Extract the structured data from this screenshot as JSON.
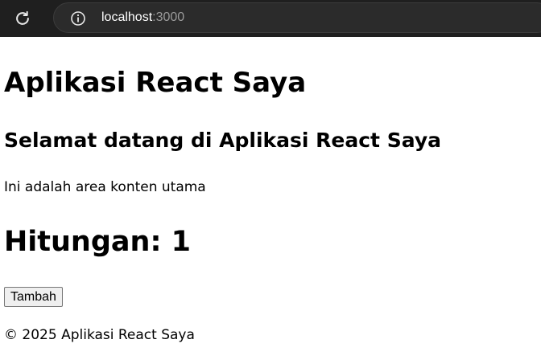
{
  "browser": {
    "url_host": "localhost",
    "url_port": ":3000",
    "icons": {
      "reload": "reload-icon",
      "site_info": "info-icon"
    }
  },
  "app": {
    "title": "Aplikasi React Saya",
    "main": {
      "heading": "Selamat datang di Aplikasi React Saya",
      "text": "Ini adalah area konten utama"
    },
    "counter": {
      "label": "Hitungan: 1",
      "value": 1,
      "button_label": "Tambah"
    },
    "footer": "© 2025 Aplikasi React Saya"
  }
}
